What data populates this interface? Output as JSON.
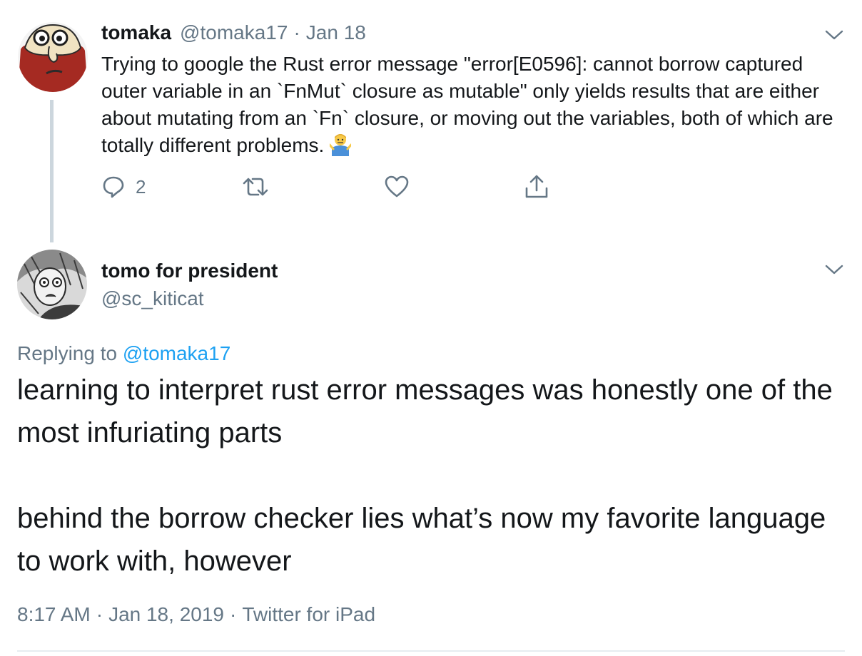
{
  "tweet1": {
    "author_name": "tomaka",
    "author_handle": "@tomaka17",
    "separator": "·",
    "date": "Jan 18",
    "text": "Trying to google the Rust error message \"error[E0596]: cannot borrow captured outer variable in an `FnMut` closure as mutable\" only yields results that are either about mutating from an `Fn` closure, or moving out the variables, both of which are totally different problems.",
    "emoji": "person-shrugging",
    "reply_count": "2",
    "icons": {
      "reply": "reply-icon",
      "retweet": "retweet-icon",
      "like": "heart-icon",
      "share": "share-icon",
      "menu": "chevron-down-icon"
    }
  },
  "tweet2": {
    "author_name": "tomo for president",
    "author_handle": "@sc_kiticat",
    "replying_prefix": "Replying to ",
    "replying_to": "@tomaka17",
    "paragraph1": "learning to interpret rust error messages was honestly one of the most infuriating parts",
    "paragraph2": "behind the borrow checker lies what’s now my favorite language to work with, however",
    "time": "8:17 AM",
    "separator": "·",
    "full_date": "Jan 18, 2019",
    "source": "Twitter for iPad"
  },
  "colors": {
    "text": "#14171a",
    "secondary": "#657786",
    "link": "#1da1f2",
    "thread_line": "#ccd6dd",
    "divider": "#e6ecf0"
  }
}
